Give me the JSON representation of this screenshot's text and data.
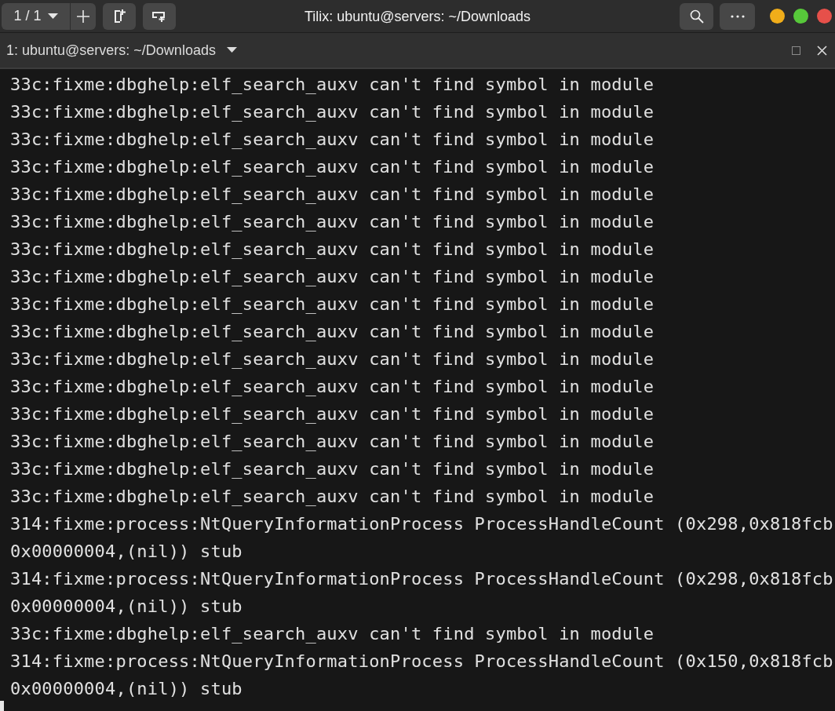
{
  "window": {
    "title": "Tilix: ubuntu@servers: ~/Downloads",
    "controls": [
      {
        "color": "#f0ad1a"
      },
      {
        "color": "#57c83a"
      },
      {
        "color": "#e6504a"
      }
    ]
  },
  "session_switcher": {
    "label": "1 / 1"
  },
  "terminal_tab": {
    "title": "1: ubuntu@servers: ~/Downloads"
  },
  "terminal_lines": [
    "33c:fixme:dbghelp:elf_search_auxv can't find symbol in module",
    "33c:fixme:dbghelp:elf_search_auxv can't find symbol in module",
    "33c:fixme:dbghelp:elf_search_auxv can't find symbol in module",
    "33c:fixme:dbghelp:elf_search_auxv can't find symbol in module",
    "33c:fixme:dbghelp:elf_search_auxv can't find symbol in module",
    "33c:fixme:dbghelp:elf_search_auxv can't find symbol in module",
    "33c:fixme:dbghelp:elf_search_auxv can't find symbol in module",
    "33c:fixme:dbghelp:elf_search_auxv can't find symbol in module",
    "33c:fixme:dbghelp:elf_search_auxv can't find symbol in module",
    "33c:fixme:dbghelp:elf_search_auxv can't find symbol in module",
    "33c:fixme:dbghelp:elf_search_auxv can't find symbol in module",
    "33c:fixme:dbghelp:elf_search_auxv can't find symbol in module",
    "33c:fixme:dbghelp:elf_search_auxv can't find symbol in module",
    "33c:fixme:dbghelp:elf_search_auxv can't find symbol in module",
    "33c:fixme:dbghelp:elf_search_auxv can't find symbol in module",
    "33c:fixme:dbghelp:elf_search_auxv can't find symbol in module",
    "314:fixme:process:NtQueryInformationProcess ProcessHandleCount (0x298,0x818fcb",
    "0x00000004,(nil)) stub",
    "314:fixme:process:NtQueryInformationProcess ProcessHandleCount (0x298,0x818fcb",
    "0x00000004,(nil)) stub",
    "33c:fixme:dbghelp:elf_search_auxv can't find symbol in module",
    "314:fixme:process:NtQueryInformationProcess ProcessHandleCount (0x150,0x818fcb",
    "0x00000004,(nil)) stub"
  ]
}
